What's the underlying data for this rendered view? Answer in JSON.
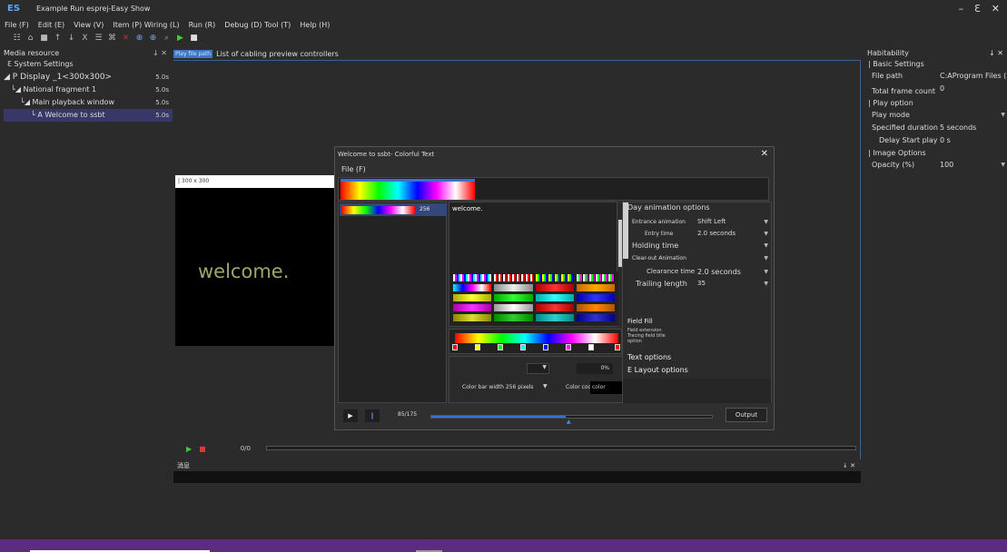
{
  "window": {
    "logo": "ES",
    "title": "Example Run esprej-Easy Show",
    "controls": [
      "–",
      "Ɛ",
      "✕"
    ]
  },
  "menu": [
    "File (F)",
    "Edit (E)",
    "View (V)",
    "Item (P) Wiring (L)",
    "Run (R)",
    "Debug (D) Tool (T)",
    "Help (H)"
  ],
  "toolbar": [
    "☷",
    "⌂",
    "■",
    "↑",
    "↓",
    "X",
    "☰",
    "⌘",
    "✕",
    "⊕",
    "⊕",
    "⌕",
    "▶",
    "■"
  ],
  "left_panel": {
    "title": "Media resource",
    "pin": "↓ ✕",
    "items": [
      {
        "label": "Ɛ System Settings",
        "dur": ""
      },
      {
        "label": "◢ P Display _1<300x300>",
        "dur": "5.0s"
      },
      {
        "label": "└◢ National fragment 1",
        "dur": "5.0s"
      },
      {
        "label": "└◢ Main playback window",
        "dur": "5.0s"
      },
      {
        "label": "└ A Welcome to ssbt",
        "dur": "5.0s"
      }
    ]
  },
  "center": {
    "tab_active": "Play file path",
    "tab_other": "List of cabling preview controllers",
    "size_label": "| 300 x 300",
    "preview_text": "welcome.",
    "play": "▶",
    "stop": "■",
    "frame_counter": "0/0"
  },
  "message_panel": {
    "title": "消息",
    "pin": "↓ ✕"
  },
  "right_panel": {
    "title": "Habitability",
    "pin": "↓ ✕",
    "basic": "| Basic Settings",
    "file_path_label": "File path",
    "file_path_value": "C:AProgram Files (x86)",
    "total_frame_label": "Total frame count",
    "total_frame_value": "0",
    "play_option": "| Play option",
    "play_mode_label": "Play mode",
    "spec_dur_label": "Specified duration",
    "spec_dur_value": "5 seconds",
    "delay_label": "Delay Start play",
    "delay_value": "0 s",
    "image_options": "| Image Options",
    "opacity_label": "Opacity (%)",
    "opacity_value": "100",
    "dropdown": "▼"
  },
  "dialog": {
    "title": "Welcome to ssbt- Colorful Text",
    "close": "✕",
    "menu": "File (F)",
    "list_count": "256",
    "text_value": "welcome.",
    "percent": "0%",
    "color_bar_width": "Color bar width 256 pixels",
    "color_code_label": "Color code",
    "color_code_value": "color",
    "opt_header": "Day animation options",
    "entrance_label": "Entrance animation",
    "entrance_value": "Shift Left",
    "entry_time_label": "Entry time",
    "entry_time_value": "2.0 seconds",
    "holding_label": "Holding time",
    "clearout_label": "Clear-out Animation",
    "clearance_label": "Clearance time",
    "clearance_value": "2.0 seconds",
    "trailing_label": "Trailing length",
    "trailing_value": "35",
    "field_fill": "Field Fill",
    "field_sub1": "Field extension",
    "field_sub2": "Tracing field title",
    "field_sub3": "option",
    "text_options": "Text options",
    "layout_options": "E Layout options",
    "play": "▶",
    "pause": "‖",
    "counter": "85/175",
    "output": "Output",
    "dropdown": "▼"
  },
  "colors": {
    "accent": "#3f77c7",
    "status_bar": "#5c2d7f",
    "preview_text": "#a1a56a",
    "selected_row": "#383868"
  }
}
